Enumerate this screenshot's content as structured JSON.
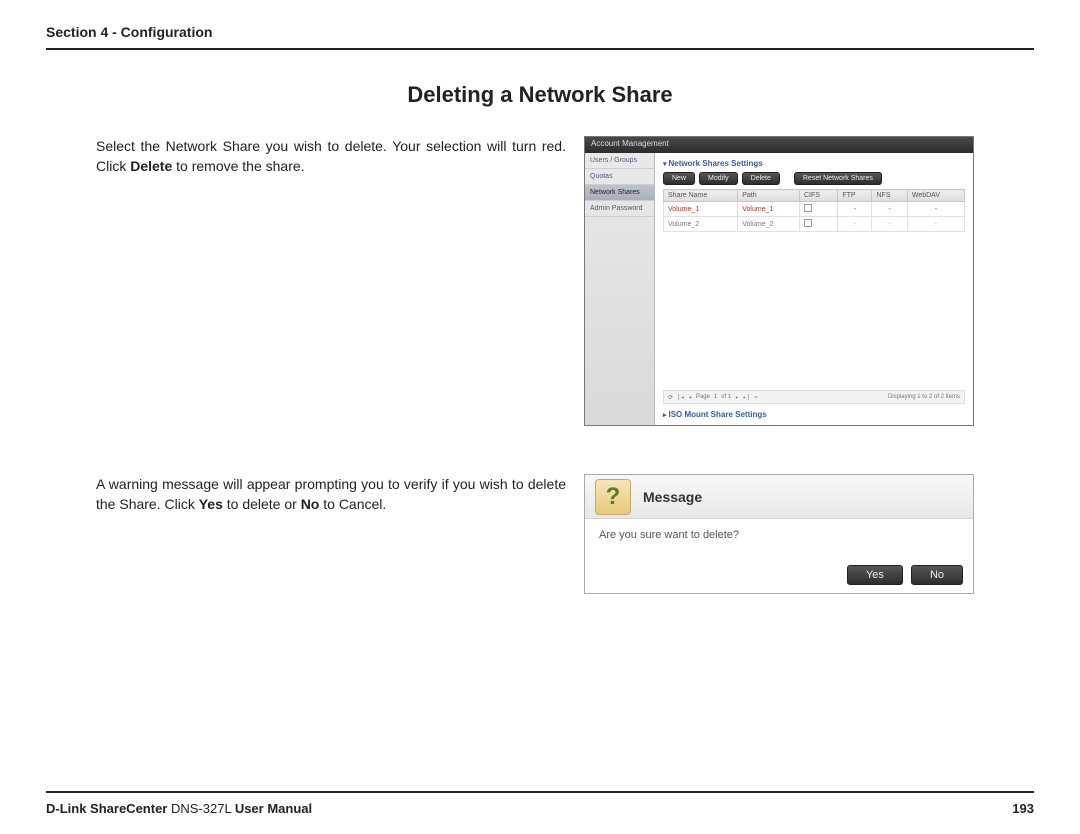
{
  "header": {
    "section_label": "Section 4 - Configuration"
  },
  "title": "Deleting a Network Share",
  "para1": {
    "pre": "Select the Network Share you wish to delete. Your selection will turn red. Click ",
    "bold": "Delete",
    "post": " to remove the share."
  },
  "para2": {
    "pre": "A warning message will appear prompting you to verify if you wish to delete the Share. Click ",
    "b1": "Yes",
    "mid": " to delete or ",
    "b2": "No",
    "post": " to Cancel."
  },
  "shot1": {
    "titlebar": "Account Management",
    "sidebar": [
      "Users / Groups",
      "Quotas",
      "Network Shares",
      "Admin Password"
    ],
    "sidebar_active_index": 2,
    "panel_title": "Network Shares Settings",
    "toolbar": {
      "new": "New",
      "modify": "Modify",
      "delete": "Delete",
      "reset": "Reset Network Shares"
    },
    "columns": [
      "Share Name",
      "Path",
      "CIFS",
      "FTP",
      "NFS",
      "WebDAV"
    ],
    "rows": [
      {
        "name": "Volume_1",
        "path": "Volume_1",
        "cifs_cb": true,
        "ftp": "-",
        "nfs": "-",
        "webdav": "-",
        "selected": true
      },
      {
        "name": "Volume_2",
        "path": "Volume_2",
        "cifs_cb": true,
        "ftp": "-",
        "nfs": "-",
        "webdav": "-",
        "selected": false
      }
    ],
    "pager": {
      "page_label": "Page",
      "page_num": "1",
      "of_label": "of 1",
      "display": "Displaying 1 to 2 of 2 items"
    },
    "section2": "ISO Mount Share Settings"
  },
  "shot2": {
    "title": "Message",
    "glyph": "?",
    "body": "Are you sure want to delete?",
    "yes": "Yes",
    "no": "No"
  },
  "footer": {
    "brand_bold": "D-Link ShareCenter",
    "model": " DNS-327L ",
    "suffix_bold": "User Manual",
    "page_num": "193"
  }
}
